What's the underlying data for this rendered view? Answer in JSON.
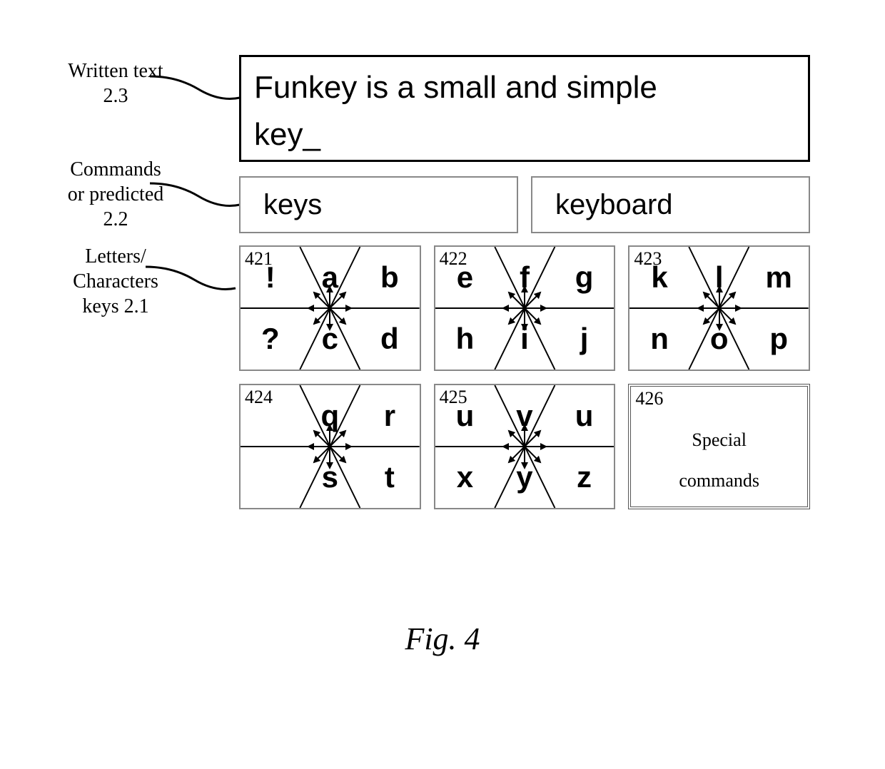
{
  "labels": {
    "written_text_l1": "Written text",
    "written_text_l2": "2.3",
    "commands_l1": "Commands",
    "commands_l2": "or predicted",
    "commands_l3": "2.2",
    "letters_l1": "Letters/",
    "letters_l2": "Characters",
    "letters_l3": "keys 2.1"
  },
  "text_box": {
    "line1": "Funkey is a small and simple",
    "line2": "key_"
  },
  "predictions": {
    "p1": "keys",
    "p2": "keyboard"
  },
  "keys": [
    {
      "num": "421",
      "letters": [
        "!",
        "a",
        "b",
        "?",
        "c",
        "d"
      ]
    },
    {
      "num": "422",
      "letters": [
        "e",
        "f",
        "g",
        "h",
        "i",
        "j"
      ]
    },
    {
      "num": "423",
      "letters": [
        "k",
        "l",
        "m",
        "n",
        "o",
        "p"
      ]
    },
    {
      "num": "424",
      "letters": [
        "",
        "q",
        "r",
        "",
        "s",
        "t"
      ]
    },
    {
      "num": "425",
      "letters": [
        "u",
        "v",
        "u",
        "x",
        "y",
        "z"
      ]
    }
  ],
  "special_key": {
    "num": "426",
    "line1": "Special",
    "line2": "commands"
  },
  "figure_caption": "Fig. 4"
}
